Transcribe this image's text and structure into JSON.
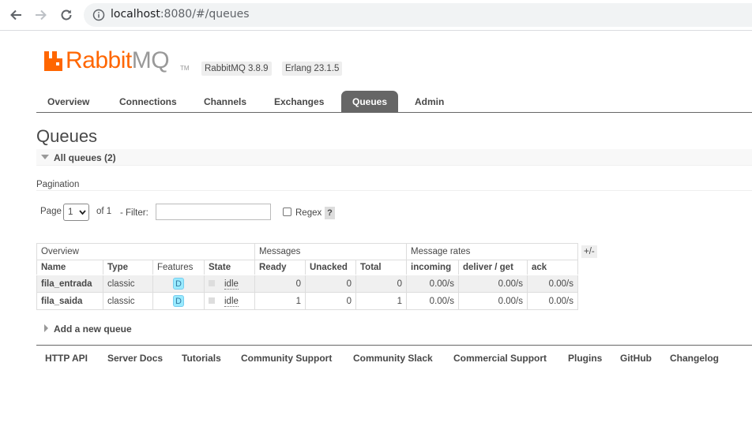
{
  "browser": {
    "url_host": "localhost",
    "url_rest": ":8080/#/queues"
  },
  "header": {
    "logo_rabbit": "Rabbit",
    "logo_mq": "MQ",
    "logo_tm": "TM",
    "rabbitmq_version": "RabbitMQ 3.8.9",
    "erlang_version": "Erlang 23.1.5"
  },
  "tabs": [
    {
      "label": "Overview"
    },
    {
      "label": "Connections"
    },
    {
      "label": "Channels"
    },
    {
      "label": "Exchanges"
    },
    {
      "label": "Queues",
      "active": true
    },
    {
      "label": "Admin"
    }
  ],
  "page": {
    "title": "Queues",
    "section_title": "All queues (2)"
  },
  "pagination": {
    "label": "Pagination",
    "page_label": "Page",
    "page_value": "1",
    "of_label": "of 1",
    "filter_label": "- Filter:",
    "filter_value": "",
    "regex_label": "Regex",
    "help": "?"
  },
  "table": {
    "groups": [
      "Overview",
      "Messages",
      "Message rates"
    ],
    "toggle_columns": "+/-",
    "columns": [
      "Name",
      "Type",
      "Features",
      "State",
      "Ready",
      "Unacked",
      "Total",
      "incoming",
      "deliver / get",
      "ack"
    ],
    "rows": [
      {
        "name": "fila_entrada",
        "type": "classic",
        "features": "D",
        "state": "idle",
        "ready": "0",
        "unacked": "0",
        "total": "0",
        "incoming": "0.00/s",
        "deliver_get": "0.00/s",
        "ack": "0.00/s"
      },
      {
        "name": "fila_saida",
        "type": "classic",
        "features": "D",
        "state": "idle",
        "ready": "1",
        "unacked": "0",
        "total": "1",
        "incoming": "0.00/s",
        "deliver_get": "0.00/s",
        "ack": "0.00/s"
      }
    ]
  },
  "add_queue": "Add a new queue",
  "footer": [
    "HTTP API",
    "Server Docs",
    "Tutorials",
    "Community Support",
    "Community Slack",
    "Commercial Support",
    "Plugins",
    "GitHub",
    "Changelog"
  ],
  "colors": {
    "brand_orange": "#ff6600",
    "tab_active": "#666666",
    "feature_badge": "#99ebff"
  }
}
